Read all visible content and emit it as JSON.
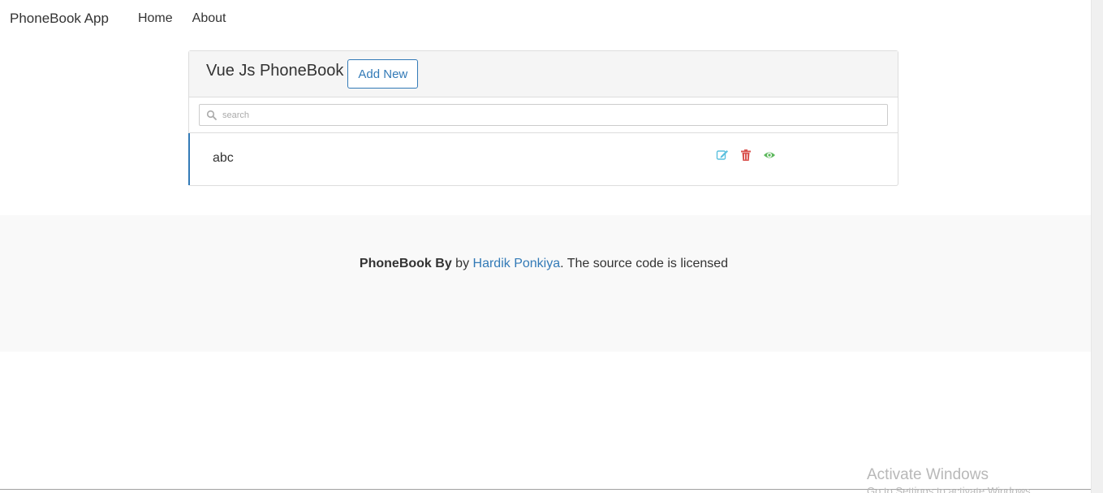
{
  "navbar": {
    "brand": "PhoneBook App",
    "links": [
      "Home",
      "About"
    ]
  },
  "panel": {
    "title": "Vue Js PhoneBook",
    "add_button": "Add New",
    "search": {
      "placeholder": "search",
      "value": ""
    },
    "contacts": [
      {
        "name": "abc"
      }
    ],
    "icons": {
      "edit": "edit-icon",
      "delete": "trash-icon",
      "view": "eye-icon"
    }
  },
  "footer": {
    "prefix_bold": "PhoneBook By",
    "by": " by ",
    "author": "Hardik Ponkiya",
    "suffix": ". The source code is licensed"
  },
  "watermark": {
    "title": "Activate Windows",
    "subtitle": "Go to Settings to activate Windows."
  },
  "colors": {
    "primary": "#337ab7",
    "danger": "#d9534f",
    "success": "#5cb85c",
    "edit": "#5bc0de"
  }
}
